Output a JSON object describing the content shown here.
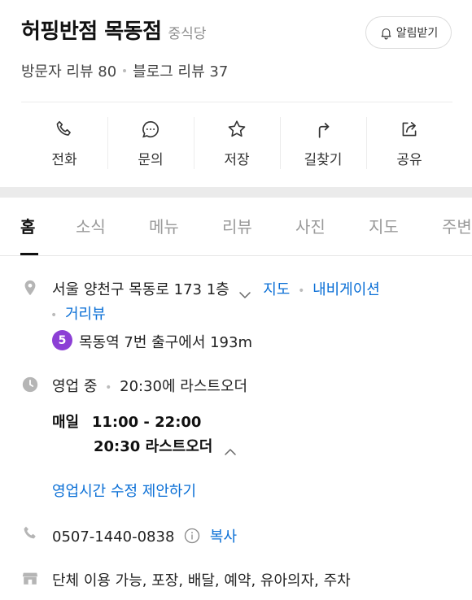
{
  "place": {
    "name": "허핑반점 목동점",
    "category": "중식당",
    "alarm_label": "알림받기",
    "visitor_reviews": "방문자 리뷰 80",
    "blog_reviews": "블로그 리뷰 37"
  },
  "actions": [
    {
      "label": "전화",
      "icon": "phone-icon"
    },
    {
      "label": "문의",
      "icon": "chat-icon"
    },
    {
      "label": "저장",
      "icon": "star-icon"
    },
    {
      "label": "길찾기",
      "icon": "directions-icon"
    },
    {
      "label": "공유",
      "icon": "share-icon"
    }
  ],
  "tabs": [
    "홈",
    "소식",
    "메뉴",
    "리뷰",
    "사진",
    "지도",
    "주변"
  ],
  "active_tab": "홈",
  "address": {
    "text": "서울 양천구 목동로 173 1층",
    "map_link": "지도",
    "navigation_link": "내비게이션",
    "street_view_link": "거리뷰",
    "subway_line": "5",
    "subway_text": "목동역 7번 출구에서 193m"
  },
  "hours": {
    "status": "영업 중",
    "last_order": "20:30에 라스트오더",
    "day": "매일",
    "time": "11:00 - 22:00",
    "last_order_detail": "20:30 라스트오더",
    "suggest_link": "영업시간 수정 제안하기"
  },
  "phone": {
    "number": "0507-1440-0838",
    "copy_label": "복사"
  },
  "amenities": "단체 이용 가능, 포장, 배달, 예약, 유아의자, 주차",
  "colors": {
    "link": "#0a6fd6",
    "subway_line_5": "#8c3fd5",
    "icon_gray": "#b5b5b5"
  }
}
